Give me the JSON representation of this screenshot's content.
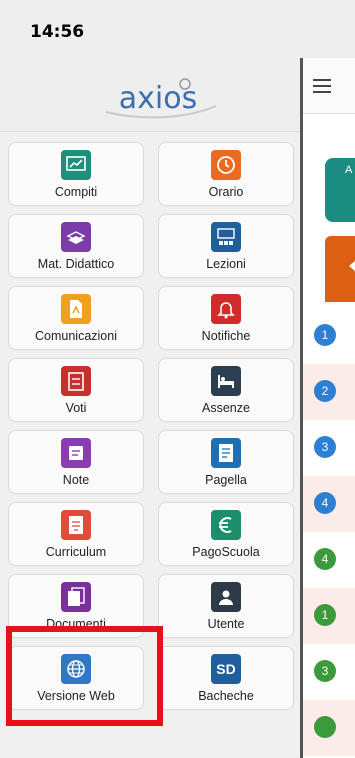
{
  "status_bar": {
    "time": "14:56"
  },
  "drawer": {
    "logo_text": "axios",
    "tiles": [
      {
        "label": "Compiti",
        "icon": "chart-board-icon",
        "color": "#1f8f7d"
      },
      {
        "label": "Orario",
        "icon": "clock-icon",
        "color": "#ea6b1f"
      },
      {
        "label": "Mat. Didattico",
        "icon": "books-icon",
        "color": "#7b3ca8"
      },
      {
        "label": "Lezioni",
        "icon": "classroom-icon",
        "color": "#1f5f9e"
      },
      {
        "label": "Comunicazioni",
        "icon": "document-icon",
        "color": "#f0a020"
      },
      {
        "label": "Notifiche",
        "icon": "bell-icon",
        "color": "#d12b2b"
      },
      {
        "label": "Voti",
        "icon": "grades-icon",
        "color": "#c8302c"
      },
      {
        "label": "Assenze",
        "icon": "bed-icon",
        "color": "#2d3e50"
      },
      {
        "label": "Note",
        "icon": "note-icon",
        "color": "#8a3db0"
      },
      {
        "label": "Pagella",
        "icon": "report-icon",
        "color": "#1e6fb4"
      },
      {
        "label": "Curriculum",
        "icon": "curriculum-icon",
        "color": "#e04b3a"
      },
      {
        "label": "PagoScuola",
        "icon": "euro-icon",
        "color": "#1a8f6a"
      },
      {
        "label": "Documenti",
        "icon": "documents-icon",
        "color": "#7a2f9a"
      },
      {
        "label": "Utente",
        "icon": "user-icon",
        "color": "#2f3a48"
      },
      {
        "label": "Versione Web",
        "icon": "globe-icon",
        "color": "#2f78c4"
      },
      {
        "label": "Bacheche",
        "icon": "sd-icon",
        "color": "#1f5f9e",
        "text": "SD"
      }
    ]
  },
  "main": {
    "teal_card_text": "A",
    "rows": [
      {
        "badge": "1",
        "color": "#2d7fd3"
      },
      {
        "badge": "2",
        "color": "#2d7fd3"
      },
      {
        "badge": "3",
        "color": "#2d7fd3"
      },
      {
        "badge": "4",
        "color": "#2d7fd3"
      },
      {
        "badge": "4",
        "color": "#3c9a3c"
      },
      {
        "badge": "1",
        "color": "#3c9a3c"
      },
      {
        "badge": "3",
        "color": "#3c9a3c"
      },
      {
        "badge": "",
        "color": "#3c9a3c"
      }
    ]
  }
}
